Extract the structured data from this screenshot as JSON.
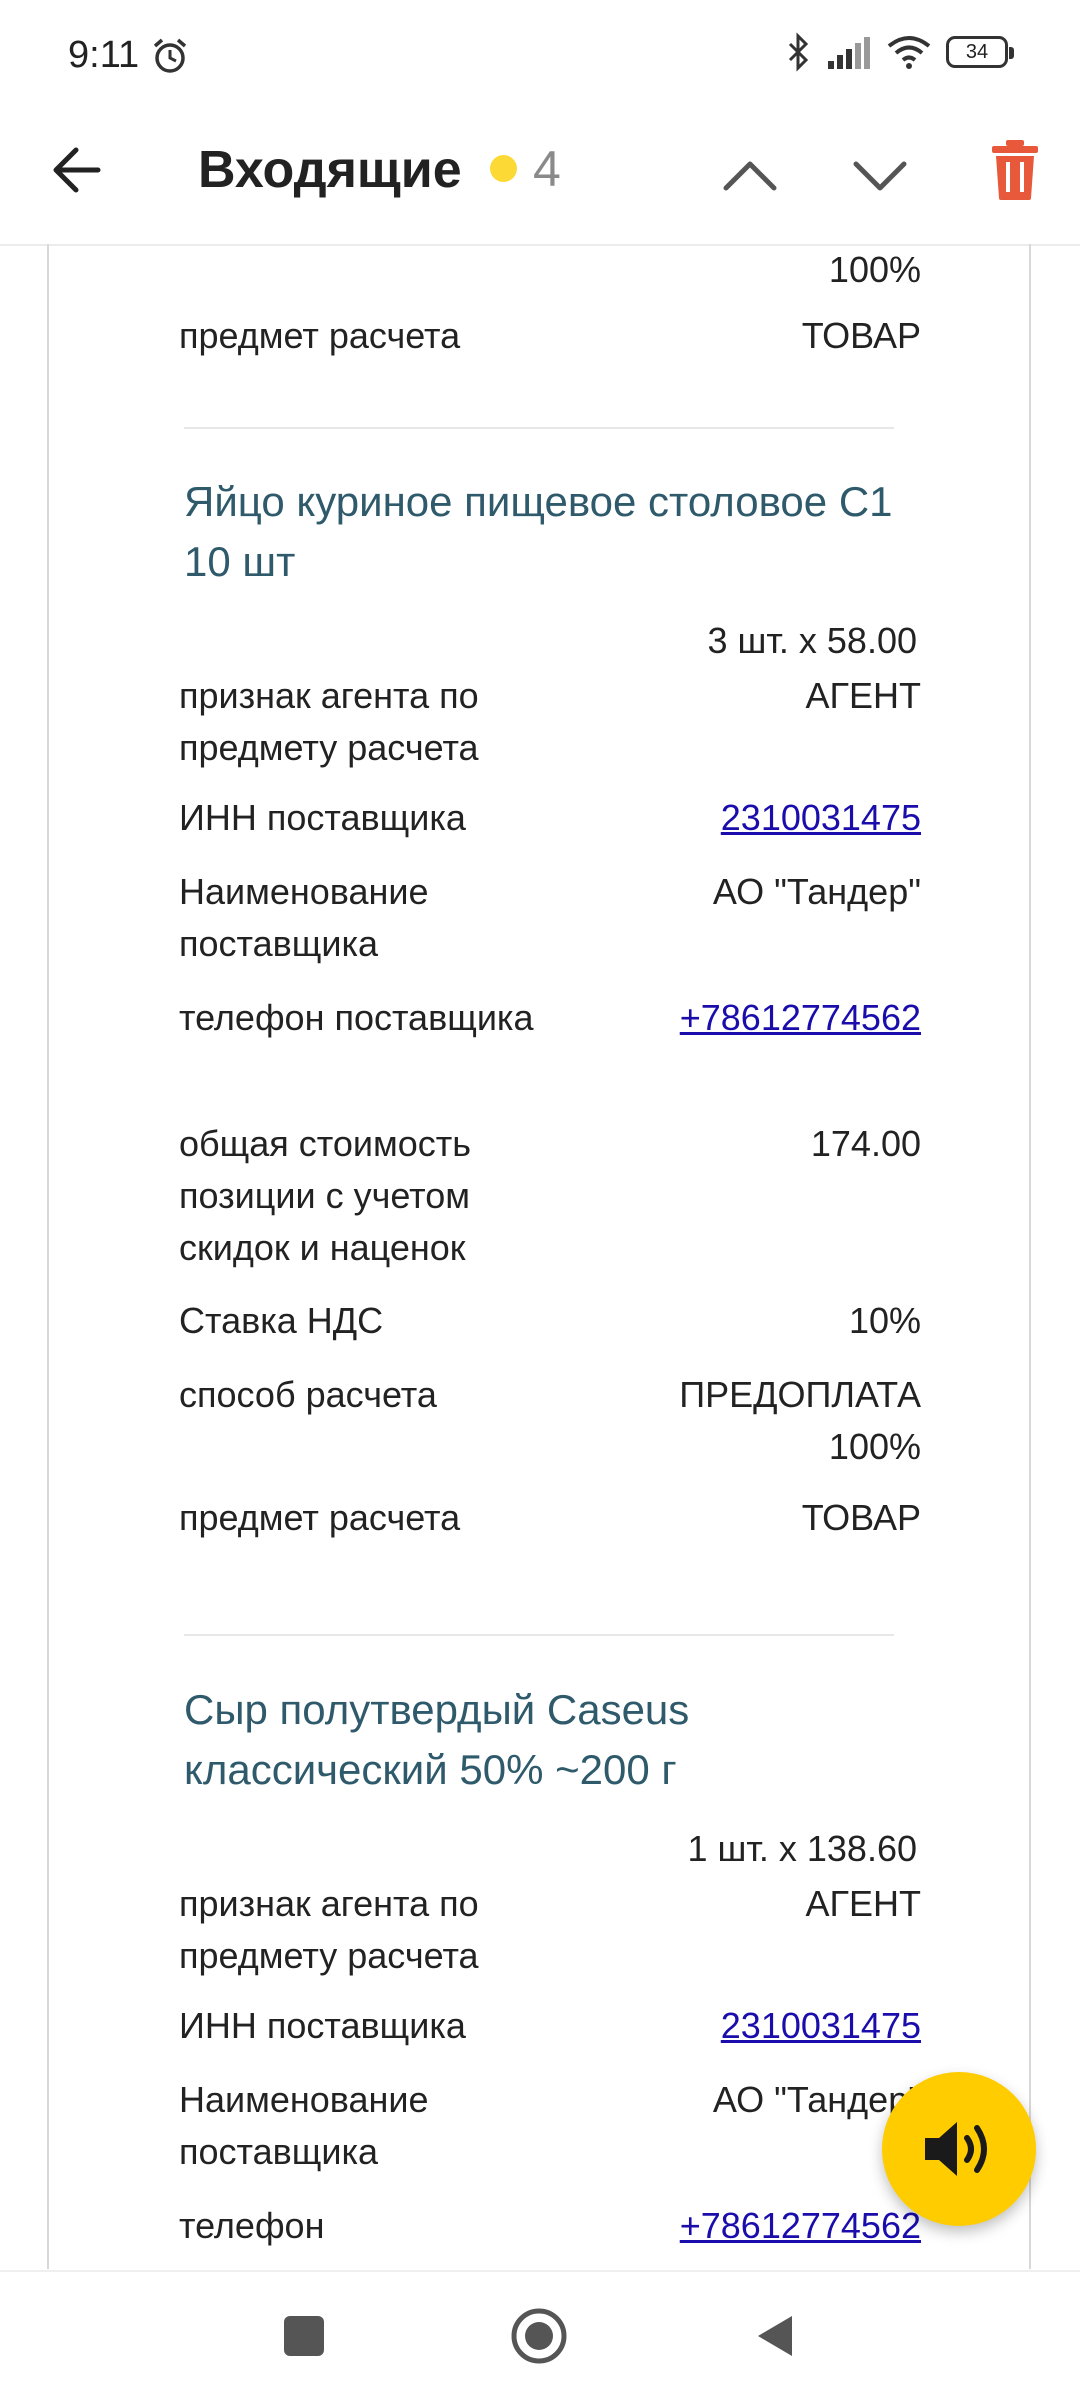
{
  "status_bar": {
    "time": "9:11",
    "battery": "34"
  },
  "header": {
    "title": "Входящие",
    "unread_count": "4"
  },
  "top_partial": {
    "method_tail": "100%",
    "subject_label": "предмет расчета",
    "subject_value": "ТОВАР"
  },
  "items": [
    {
      "title": "Яйцо куриное пищевое столовое С1 10 шт",
      "qty": "3 шт. х 58.00",
      "agent_label": "признак агента по предмету расчета",
      "agent_value": "АГЕНТ",
      "inn_label": "ИНН поставщика",
      "inn_value": "2310031475",
      "name_label": "Наименование поставщика",
      "name_value": "АО \"Тандер\"",
      "phone_label": "телефон поставщика",
      "phone_value": "+78612774562",
      "total_label": "общая стоимость позиции с учетом скидок и наценок",
      "total_value": "174.00",
      "vat_label": "Ставка НДС",
      "vat_value": "10%",
      "method_label": "способ расчета",
      "method_value": "ПРЕДОПЛАТА 100%",
      "subject_label": "предмет расчета",
      "subject_value": "ТОВАР"
    },
    {
      "title": "Сыр полутвердый Caseus классический 50% ~200 г",
      "qty": "1 шт. х 138.60",
      "agent_label": "признак агента по предмету расчета",
      "agent_value": "АГЕНТ",
      "inn_label": "ИНН поставщика",
      "inn_value": "2310031475",
      "name_label": "Наименование поставщика",
      "name_value": "АО \"Тандер\"",
      "phone_label": "телефон",
      "phone_value": "+78612774562"
    }
  ],
  "colors": {
    "accent_yellow": "#ffcc00",
    "trash_red": "#e8593c",
    "link_blue": "#1a0dab",
    "title_teal": "#2f5a6b"
  },
  "icons": [
    "back-arrow-icon",
    "chevron-up-icon",
    "chevron-down-icon",
    "trash-icon",
    "speaker-icon",
    "alarm-icon",
    "bluetooth-icon",
    "signal-icon",
    "wifi-icon",
    "battery-icon",
    "square-nav-icon",
    "home-nav-icon",
    "back-nav-icon"
  ]
}
